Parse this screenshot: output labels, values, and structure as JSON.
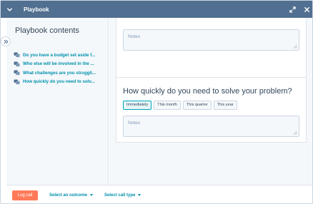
{
  "header": {
    "title": "Playbook",
    "bg_color": "#516f90"
  },
  "sidebar": {
    "heading": "Playbook contents",
    "items": [
      {
        "label": "Do you have a budget set aside f..."
      },
      {
        "label": "Who else will be involved in the ..."
      },
      {
        "label": "What challenges are you struggli..."
      },
      {
        "label": "How quickly do you need to solv..."
      }
    ],
    "icon": "question-bubble-icon",
    "link_color": "#0091ae"
  },
  "main": {
    "card1": {
      "notes_placeholder": "Notes"
    },
    "card2": {
      "question": "How quickly do you need to solve your problem?",
      "options": [
        "Immediately",
        "This month",
        "This quarter",
        "This year"
      ],
      "selected_option": "Immediately",
      "notes_placeholder": "Notes"
    }
  },
  "footer": {
    "log_call_label": "Log call",
    "outcome_label": "Select an outcome",
    "call_type_label": "Select call type",
    "accent": "#ff7a59"
  }
}
